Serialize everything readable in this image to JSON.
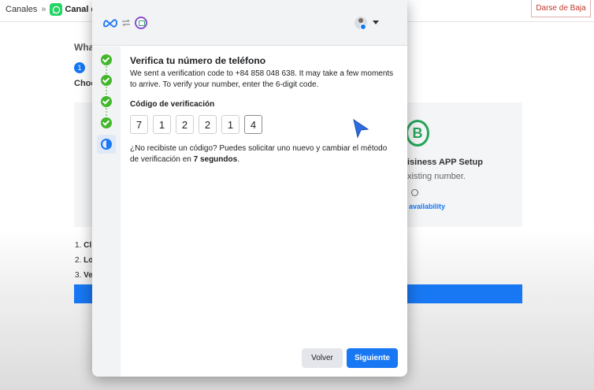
{
  "background": {
    "breadcrumb": {
      "root": "Canales",
      "separator": "»",
      "current": "Canal d"
    },
    "darse_button": "Darse de Baja",
    "question_partial": "Wha",
    "step_number": "1",
    "choose_partial": "Choo",
    "card": {
      "logo_letter": "B",
      "title_partial": "isiness APP Setup",
      "subtitle_partial": "xisting number.",
      "availability_link": "availability"
    },
    "list": [
      {
        "num": "1.",
        "text": "Cl"
      },
      {
        "num": "2.",
        "text": "Lo"
      },
      {
        "num": "3.",
        "text": "Ve"
      }
    ]
  },
  "modal": {
    "title": "Verifica tu número de teléfono",
    "description": "We sent a verification code to +84 858 048 638. It may take a few moments to arrive. To verify your number, enter the 6-digit code.",
    "code_label": "Código de verificación",
    "code_digits": [
      "7",
      "1",
      "2",
      "2",
      "1",
      "4"
    ],
    "resend_text": "¿No recibiste un código? Puedes solicitar uno nuevo y cambiar el método de verificación en",
    "resend_countdown": "7 segundos",
    "resend_suffix": ".",
    "buttons": {
      "back": "Volver",
      "next": "Siguiente"
    },
    "steps": [
      "done",
      "done",
      "done",
      "done",
      "active"
    ]
  },
  "colors": {
    "primary": "#1877f2",
    "success": "#42b72a",
    "whatsapp": "#25d366",
    "danger": "#c0392b"
  },
  "icons": [
    "whatsapp-icon",
    "meta-logo-icon",
    "swap-icon",
    "business-logo-icon",
    "avatar",
    "facebook-badge-icon",
    "chevron-down-icon",
    "check-icon",
    "half-circle-icon",
    "cursor-arrow-icon"
  ]
}
